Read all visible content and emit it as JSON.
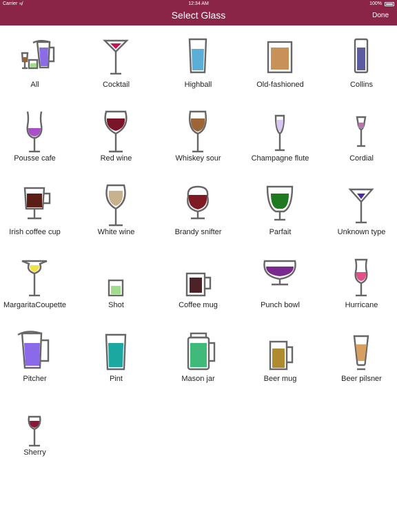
{
  "status": {
    "carrier": "Carrier",
    "time": "12:34 AM",
    "battery": "100%"
  },
  "nav": {
    "title": "Select Glass",
    "done_label": "Done"
  },
  "glasses": [
    {
      "label": "All",
      "liquid": "#8b6be6"
    },
    {
      "label": "Cocktail",
      "liquid": "#c2185b"
    },
    {
      "label": "Highball",
      "liquid": "#5bafd6"
    },
    {
      "label": "Old-fashioned",
      "liquid": "#c8915a"
    },
    {
      "label": "Collins",
      "liquid": "#5a5ba0"
    },
    {
      "label": "Pousse cafe",
      "liquid": "#a94fc7"
    },
    {
      "label": "Red wine",
      "liquid": "#7a1428"
    },
    {
      "label": "Whiskey sour",
      "liquid": "#9b6535"
    },
    {
      "label": "Champagne flute",
      "liquid": "#d8c6f0"
    },
    {
      "label": "Cordial",
      "liquid": "#b07aa8"
    },
    {
      "label": "Irish coffee cup",
      "liquid": "#5a1e16"
    },
    {
      "label": "White wine",
      "liquid": "#c8b28e"
    },
    {
      "label": "Brandy snifter",
      "liquid": "#7d1a24"
    },
    {
      "label": "Parfait",
      "liquid": "#1f7a1f"
    },
    {
      "label": "Unknown  type",
      "liquid": "#4a2aa0"
    },
    {
      "label": "MargaritaCoupette",
      "liquid": "#f0e34a"
    },
    {
      "label": "Shot",
      "liquid": "#9fdc8c"
    },
    {
      "label": "Coffee mug",
      "liquid": "#4a2228"
    },
    {
      "label": "Punch bowl",
      "liquid": "#7a2a8e"
    },
    {
      "label": "Hurricane",
      "liquid": "#e0508a"
    },
    {
      "label": "Pitcher",
      "liquid": "#8a6ae8"
    },
    {
      "label": "Pint",
      "liquid": "#1aa8a0"
    },
    {
      "label": "Mason jar",
      "liquid": "#3fba78"
    },
    {
      "label": "Beer mug",
      "liquid": "#b08a2e"
    },
    {
      "label": "Beer pilsner",
      "liquid": "#d8a060"
    },
    {
      "label": "Sherry",
      "liquid": "#8a1838"
    }
  ]
}
